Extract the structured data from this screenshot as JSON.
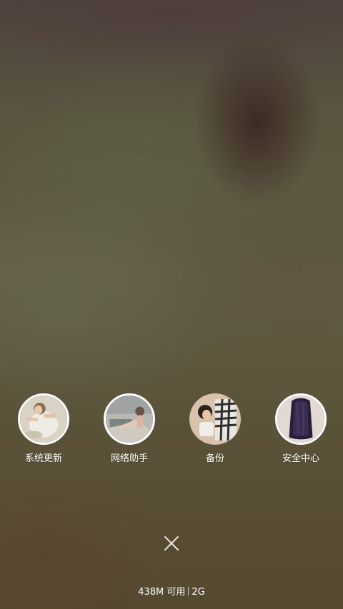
{
  "shortcuts": [
    {
      "label": "系统更新",
      "icon": "system-update-thumbnail-icon"
    },
    {
      "label": "网络助手",
      "icon": "network-assistant-thumbnail-icon"
    },
    {
      "label": "备份",
      "icon": "backup-thumbnail-icon"
    },
    {
      "label": "安全中心",
      "icon": "security-center-thumbnail-icon"
    }
  ],
  "close": {
    "icon": "close-icon"
  },
  "memory": {
    "available": "438M 可用",
    "total": "2G"
  },
  "colors": {
    "text": "#ffffff",
    "ring": "#ffffff",
    "background": "#5a5238"
  }
}
